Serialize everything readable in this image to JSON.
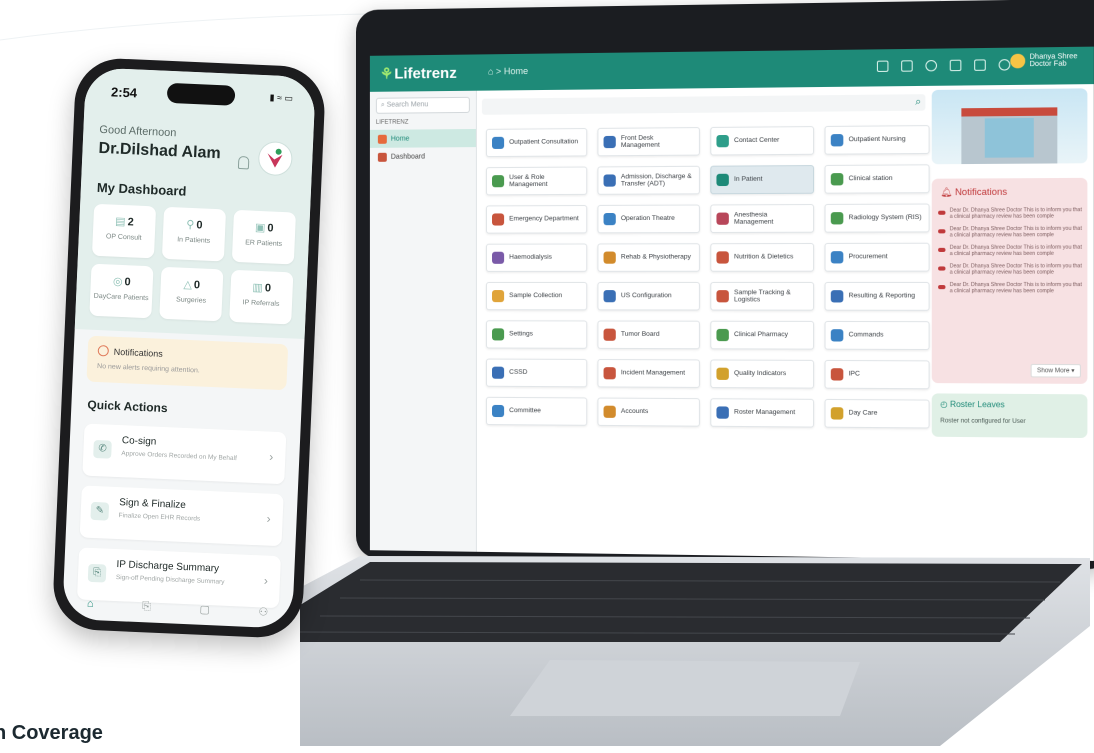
{
  "caption": "n Coverage",
  "phone": {
    "status_time": "2:54",
    "status_icons": "▮ ≈ ▭",
    "greeting": "Good Afternoon",
    "doctor_name": "Dr.Dilshad Alam",
    "dashboard_title": "My Dashboard",
    "stats": [
      {
        "value": "2",
        "label": "OP Consult"
      },
      {
        "value": "0",
        "label": "In Patients"
      },
      {
        "value": "0",
        "label": "ER Patients"
      },
      {
        "value": "0",
        "label": "DayCare Patients"
      },
      {
        "value": "0",
        "label": "Surgeries"
      },
      {
        "value": "0",
        "label": "IP Referrals"
      }
    ],
    "notifications": {
      "title": "Notifications",
      "message": "No new alerts requiring attention."
    },
    "quick_actions_title": "Quick Actions",
    "quick_actions": [
      {
        "title": "Co-sign",
        "subtitle": "Approve Orders Recorded on My Behalf"
      },
      {
        "title": "Sign & Finalize",
        "subtitle": "Finalize Open EHR Records"
      },
      {
        "title": "IP Discharge Summary",
        "subtitle": "Sign-off Pending Discharge Summary"
      }
    ]
  },
  "laptop": {
    "logo": "Lifetrenz",
    "breadcrumb": "Home",
    "user": "Dhanya Shree Doctor Fab",
    "sidebar": {
      "search_placeholder": "Search Menu",
      "section": "LIFETRENZ",
      "items": [
        {
          "label": "Home"
        },
        {
          "label": "Dashboard"
        }
      ]
    },
    "tiles": [
      {
        "label": "Outpatient Consultation",
        "color": "#3b82c4"
      },
      {
        "label": "Front Desk Management",
        "color": "#3a6fb5"
      },
      {
        "label": "Contact Center",
        "color": "#2e9e8a"
      },
      {
        "label": "Outpatient Nursing",
        "color": "#3b82c4"
      },
      {
        "label": "User & Role Management",
        "color": "#4a9a4f"
      },
      {
        "label": "Admission, Discharge & Transfer (ADT)",
        "color": "#3a6fb5"
      },
      {
        "label": "In Patient",
        "color": "#1e8a78"
      },
      {
        "label": "Clinical station",
        "color": "#4a9a4f"
      },
      {
        "label": "Emergency Department",
        "color": "#c8553d"
      },
      {
        "label": "Operation Theatre",
        "color": "#3b82c4"
      },
      {
        "label": "Anesthesia Management",
        "color": "#b8475a"
      },
      {
        "label": "Radiology System (RIS)",
        "color": "#4a9a4f"
      },
      {
        "label": "Haemodialysis",
        "color": "#7a5aa8"
      },
      {
        "label": "Rehab & Physiotherapy",
        "color": "#d28b2c"
      },
      {
        "label": "Nutrition & Dietetics",
        "color": "#c8553d"
      },
      {
        "label": "Procurement",
        "color": "#3b82c4"
      },
      {
        "label": "Sample Collection",
        "color": "#e0a43a"
      },
      {
        "label": "US Configuration",
        "color": "#3a6fb5"
      },
      {
        "label": "Sample Tracking & Logistics",
        "color": "#c8553d"
      },
      {
        "label": "Resulting & Reporting",
        "color": "#3a6fb5"
      },
      {
        "label": "Settings",
        "color": "#4a9a4f"
      },
      {
        "label": "Tumor Board",
        "color": "#c8553d"
      },
      {
        "label": "Clinical Pharmacy",
        "color": "#4a9a4f"
      },
      {
        "label": "Commands",
        "color": "#3b82c4"
      },
      {
        "label": "CSSD",
        "color": "#3a6fb5"
      },
      {
        "label": "Incident Management",
        "color": "#c8553d"
      },
      {
        "label": "Quality Indicators",
        "color": "#d2a12c"
      },
      {
        "label": "IPC",
        "color": "#c8553d"
      },
      {
        "label": "Committee",
        "color": "#3b82c4"
      },
      {
        "label": "Accounts",
        "color": "#d28b2c"
      },
      {
        "label": "Roster Management",
        "color": "#3a6fb5"
      },
      {
        "label": "Day Care",
        "color": "#d2a12c"
      }
    ],
    "notifications_card": {
      "title": "Notifications",
      "items": [
        "Dear Dr. Dhanya Shree Doctor This is to inform you that a clinical pharmacy review has been comple",
        "Dear Dr. Dhanya Shree Doctor This is to inform you that a clinical pharmacy review has been comple",
        "Dear Dr. Dhanya Shree Doctor This is to inform you that a clinical pharmacy review has been comple",
        "Dear Dr. Dhanya Shree Doctor This is to inform you that a clinical pharmacy review has been comple",
        "Dear Dr. Dhanya Shree Doctor This is to inform you that a clinical pharmacy review has been comple"
      ],
      "show_more": "Show More"
    },
    "roster_card": {
      "title": "Roster Leaves",
      "text": "Roster not configured for User"
    }
  }
}
